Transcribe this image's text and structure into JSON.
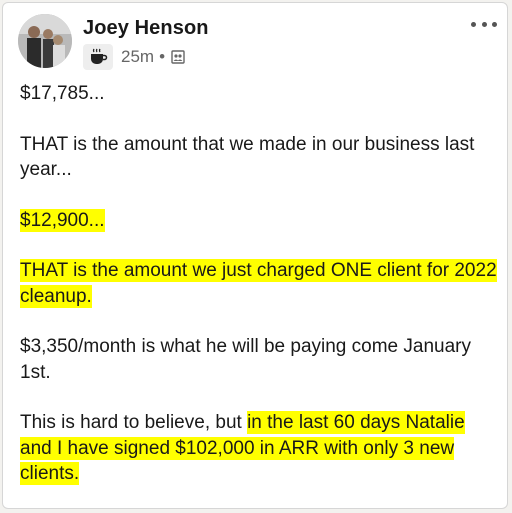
{
  "post": {
    "author_name": "Joey Henson",
    "timestamp": "25m",
    "separator": "•",
    "badge_icon": "coffee-cup-icon",
    "visibility_icon": "connections-icon",
    "more_icon": "more-options-icon"
  },
  "content": {
    "p1_line": "$17,785...",
    "p2_line": "THAT is the amount that we made in our business last year...",
    "p3_line": "$12,900...",
    "p4_line": "THAT is the amount we just charged ONE client for 2022 cleanup.",
    "p5_line": "$3,350/month is what he will be paying come January 1st.",
    "p6_plain": "This is hard to believe, but ",
    "p6_highlight": "in the last 60 days Natalie and I have signed $102,000 in ARR with only 3 new clients."
  },
  "colors": {
    "highlight": "#ffff00",
    "text": "#191919",
    "meta": "#666666"
  }
}
